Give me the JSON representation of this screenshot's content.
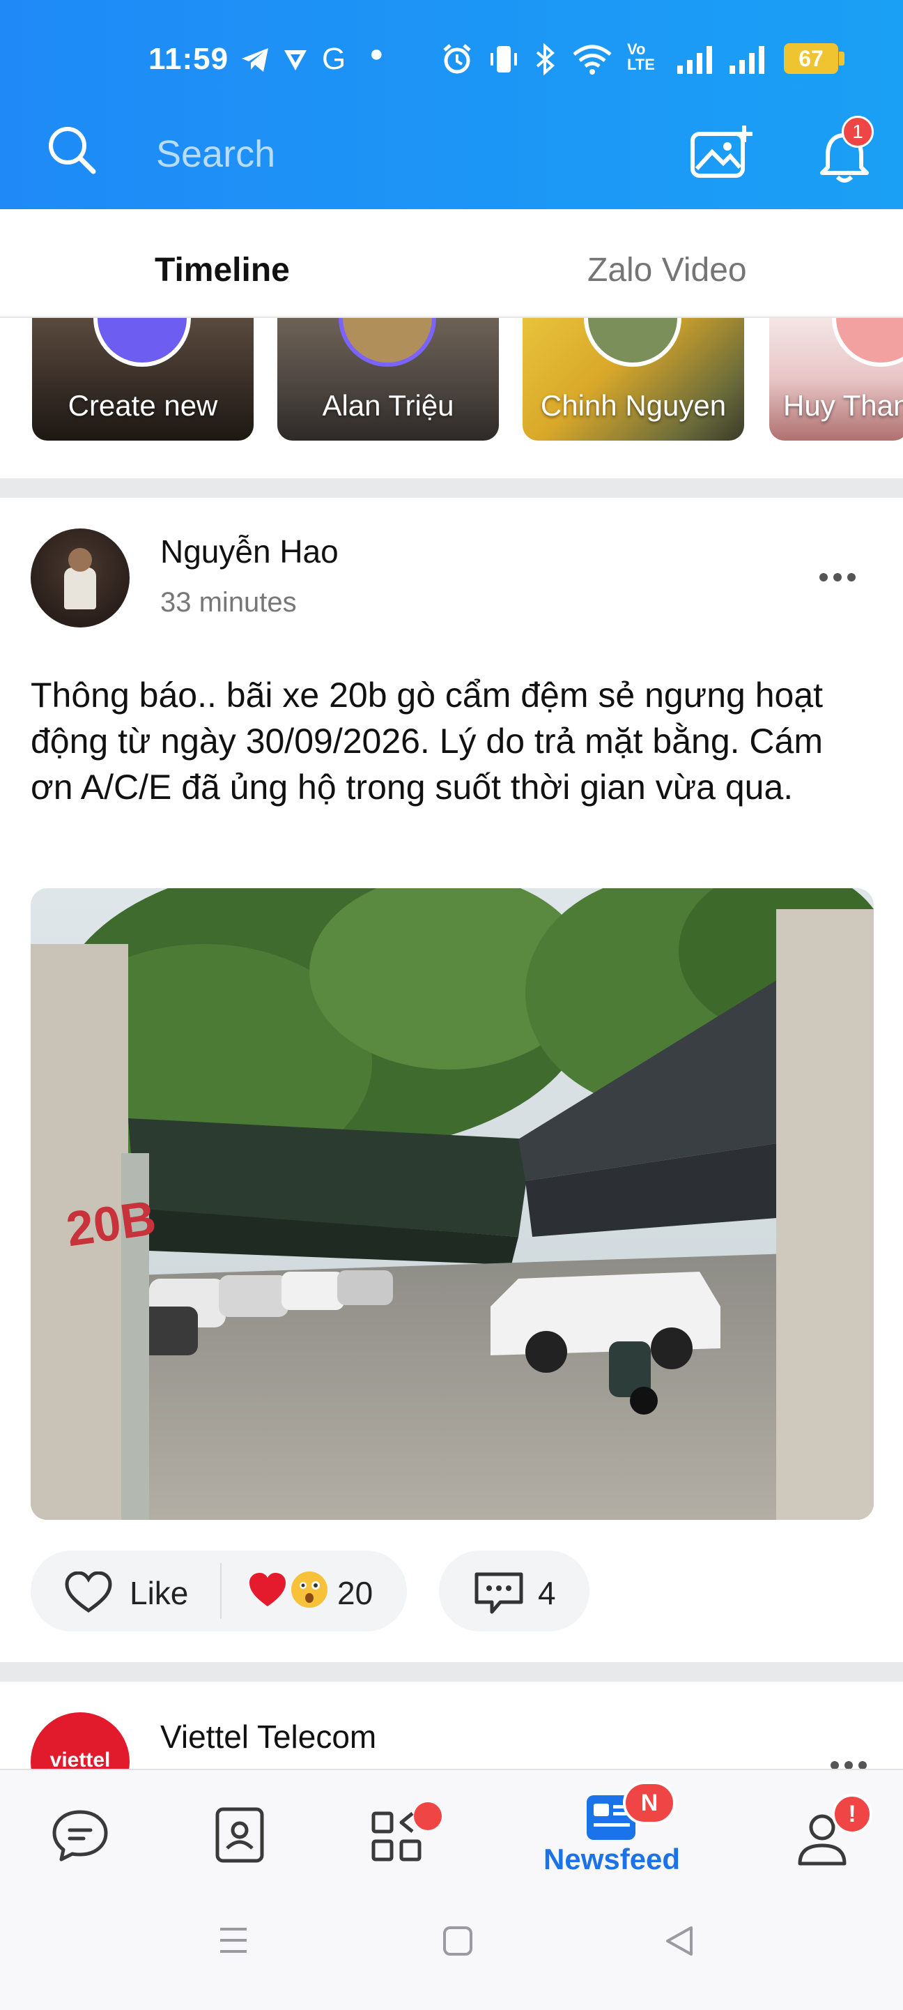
{
  "status_bar": {
    "time": "11:59",
    "battery": "67",
    "network_label_top": "Vo",
    "network_label_bottom": "LTE"
  },
  "header": {
    "search_placeholder": "Search",
    "notification_count": "1",
    "brand_color": "#1f8af7"
  },
  "tabs": [
    {
      "label": "Timeline",
      "active": true
    },
    {
      "label": "Zalo Video",
      "active": false
    }
  ],
  "stories": [
    {
      "label": "Create new"
    },
    {
      "label": "Alan Triệu"
    },
    {
      "label": "Chinh Nguyen"
    },
    {
      "label": "Huy Than"
    }
  ],
  "post": {
    "author": "Nguyễn Hao",
    "time": "33 minutes",
    "text": "Thông báo.. bãi xe 20b gò cẩm đệm sẻ ngưng hoạt động từ ngày 30/09/2026. Lý do trả mặt bằng. Cám ơn A/C/E đã ủng hộ trong suốt thời gian vừa qua.",
    "photo_marking": "20B",
    "like_label": "Like",
    "reaction_count": "20",
    "comment_count": "4"
  },
  "next_post": {
    "author": "Viettel Telecom",
    "logo_text": "viettel"
  },
  "bottom_nav": {
    "items": [
      {
        "name": "messages",
        "icon": "chat-icon"
      },
      {
        "name": "contacts",
        "icon": "contact-card-icon"
      },
      {
        "name": "discover",
        "icon": "apps-grid-icon"
      },
      {
        "name": "newsfeed",
        "icon": "newsfeed-icon",
        "label": "Newsfeed",
        "active": true,
        "badge": "N"
      },
      {
        "name": "profile",
        "icon": "person-icon",
        "badge": "!"
      }
    ]
  }
}
